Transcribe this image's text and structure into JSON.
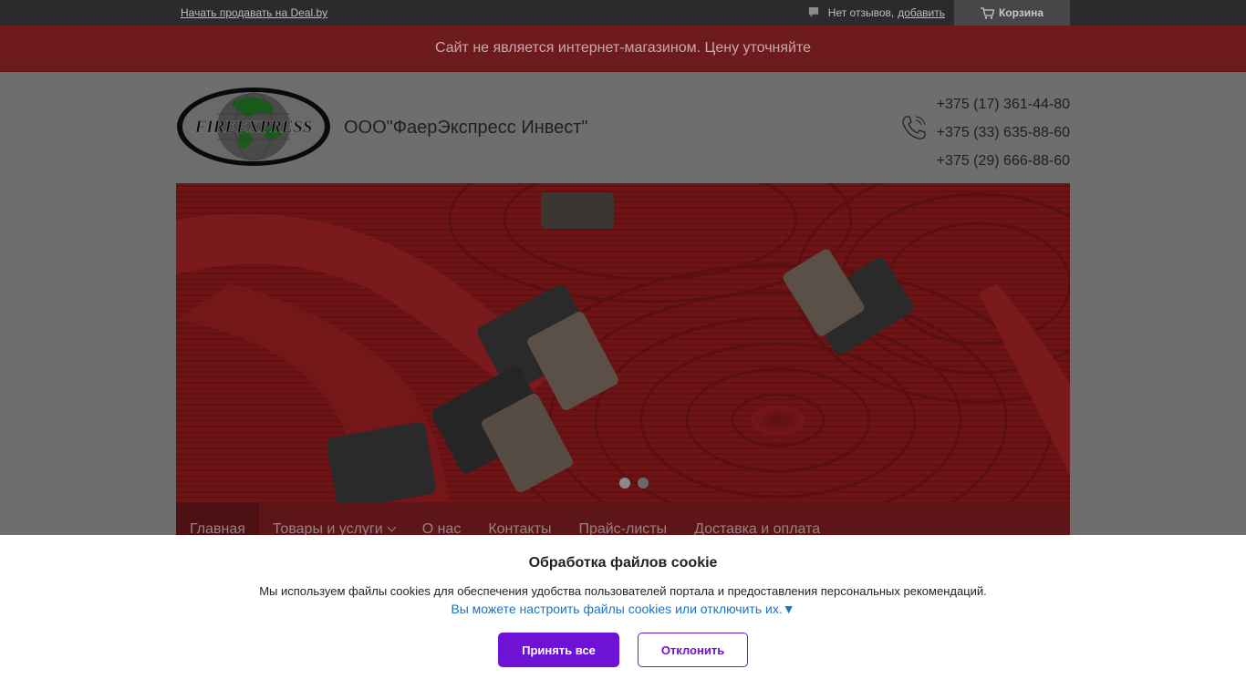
{
  "topbar": {
    "sell_link": "Начать продавать на Deal.by",
    "reviews_text": "Нет отзывов,",
    "reviews_add": "добавить",
    "cart_label": "Корзина"
  },
  "notice": "Сайт не является интернет-магазином. Цену уточняйте",
  "header": {
    "logo_text": "FIREEXPRESS",
    "company": "ООО\"ФаерЭкспресс Инвест\"",
    "phones": [
      "+375 (17) 361-44-80",
      "+375 (33) 635-88-60",
      "+375 (29) 666-88-60"
    ]
  },
  "banner": {
    "slides": 2,
    "active_slide": 1
  },
  "nav": {
    "items": [
      {
        "label": "Главная"
      },
      {
        "label": "Товары и услуги"
      },
      {
        "label": "О нас"
      },
      {
        "label": "Контакты"
      },
      {
        "label": "Прайс-листы"
      },
      {
        "label": "Доставка и оплата"
      }
    ]
  },
  "cookie": {
    "title": "Обработка файлов cookie",
    "text": "Мы используем файлы cookies для обеспечения удобства пользователей портала и предоставления персональных рекомендаций.",
    "link": "Вы можете настроить файлы cookies или отключить их.▼",
    "accept": "Принять все",
    "decline": "Отклонить"
  },
  "colors": {
    "accent": "#6e12d6",
    "link": "#1a73c8",
    "brand": "#6e1b1d"
  }
}
